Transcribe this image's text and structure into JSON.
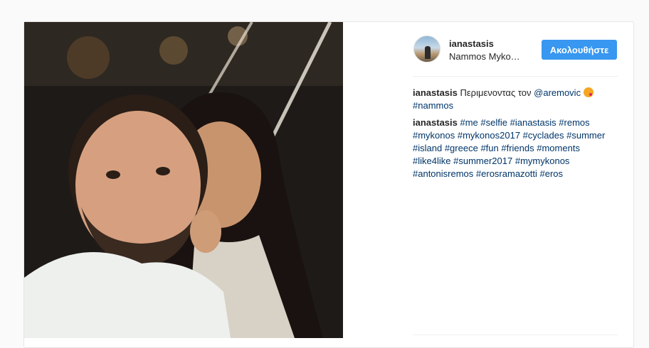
{
  "post": {
    "username": "ianastasis",
    "location": "Nammos Myko…",
    "follow_label": "Ακολουθήστε",
    "comments": [
      {
        "username": "ianastasis",
        "text": "Περιμενοντας τον",
        "mention": "@aremovic",
        "emoji": "kiss-emoji",
        "tags": [
          "#nammos"
        ]
      },
      {
        "username": "ianastasis",
        "tags": [
          "#me",
          "#selfie",
          "#ianastasis",
          "#remos",
          "#mykonos",
          "#mykonos2017",
          "#cyclades",
          "#summer",
          "#island",
          "#greece",
          "#fun",
          "#friends",
          "#moments",
          "#like4like",
          "#summer2017",
          "#mymykonos",
          "#antonisremos",
          "#erosramazotti",
          "#eros"
        ]
      }
    ]
  },
  "colors": {
    "accent": "#3897f0",
    "link": "#003569",
    "text": "#262626",
    "background": "#fafafa"
  }
}
